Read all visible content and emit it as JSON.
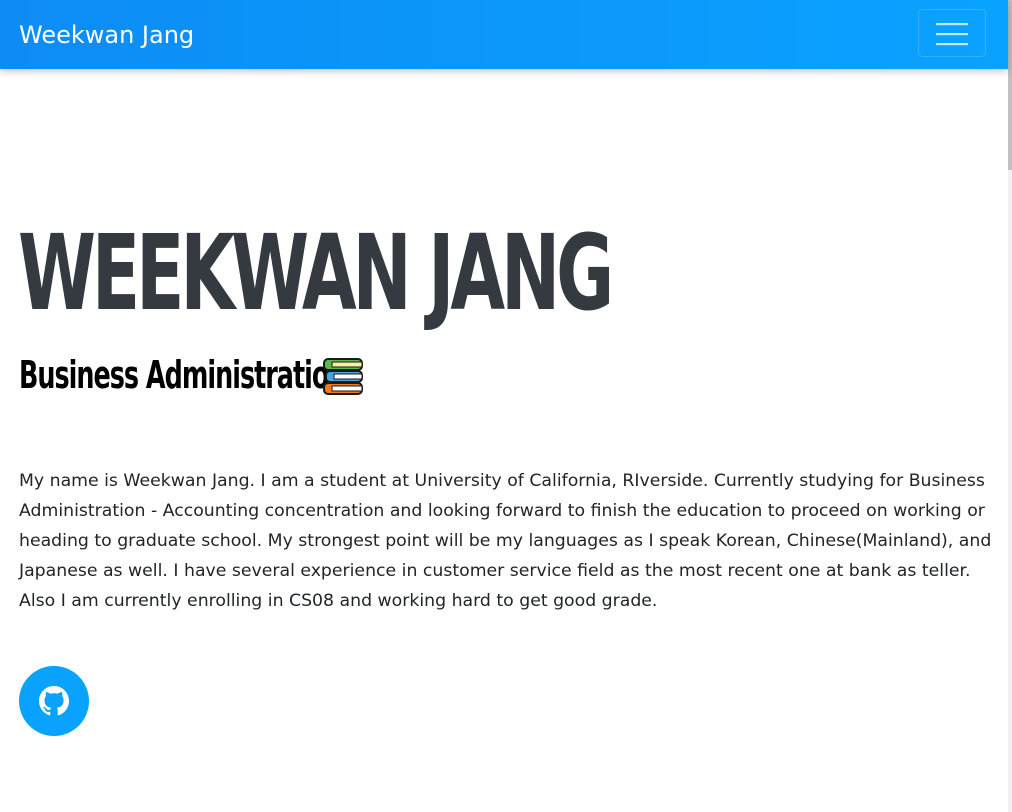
{
  "navbar": {
    "brand": "Weekwan Jang",
    "toggler_icon": "hamburger-menu-icon"
  },
  "hero": {
    "name": "WEEKWAN JANG",
    "subtitle": "Business Administration",
    "subtitle_icon": "books-icon"
  },
  "about": {
    "text": "My name is Weekwan Jang. I am a student at University of California, RIverside. Currently studying for Business Administration - Accounting concentration and looking forward to finish the education to proceed on working or heading to graduate school. My strongest point will be my languages as I speak Korean, Chinese(Mainland), and Japanese as well. I have several experience in customer service field as the most recent one at bank as teller. Also I am currently enrolling in CS08 and working hard to get good grade."
  },
  "social": {
    "github_icon": "github-icon"
  },
  "colors": {
    "accent": "#0aa2ff",
    "heading": "#343a40",
    "text": "#212529"
  }
}
